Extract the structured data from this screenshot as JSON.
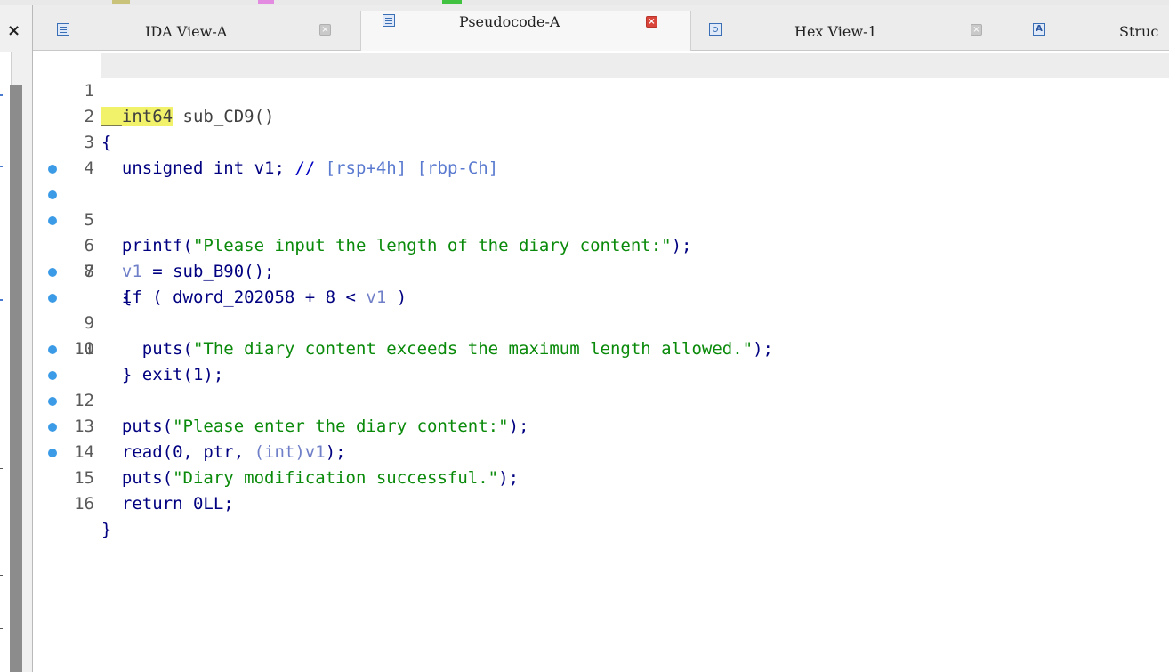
{
  "tabs": [
    {
      "label": "IDA View-A",
      "icon": "ida-view-icon",
      "active": false
    },
    {
      "label": "Pseudocode-A",
      "icon": "pseudocode-icon",
      "active": true
    },
    {
      "label": "Hex View-1",
      "icon": "hex-view-icon",
      "active": false
    },
    {
      "label": "Struc",
      "icon": "structures-icon",
      "active": false
    }
  ],
  "struc_icon_letter": "A",
  "left_close": "×",
  "code": {
    "lines": [
      {
        "n": "1",
        "bp": false
      },
      {
        "n": "2",
        "bp": false
      },
      {
        "n": "3",
        "bp": false
      },
      {
        "n": "4",
        "bp": false
      },
      {
        "n": "5",
        "bp": true
      },
      {
        "n": "6",
        "bp": true
      },
      {
        "n": "7",
        "bp": true
      },
      {
        "n": "8",
        "bp": false
      },
      {
        "n": "9",
        "bp": true
      },
      {
        "n": "10",
        "bp": true
      },
      {
        "n": "11",
        "bp": false
      },
      {
        "n": "12",
        "bp": true
      },
      {
        "n": "13",
        "bp": true
      },
      {
        "n": "14",
        "bp": true
      },
      {
        "n": "15",
        "bp": true
      },
      {
        "n": "16",
        "bp": true
      }
    ],
    "l1": {
      "type": "__int64",
      "name": " sub_CD9()"
    },
    "l2": {
      "text": "{"
    },
    "l3": {
      "decl": "  unsigned int v1; ",
      "comment": "// ",
      "addr": "[rsp+4h] [rbp-Ch]"
    },
    "l5": {
      "pre": "  printf(",
      "str": "\"Please input the length of the diary content:\"",
      "post": ");"
    },
    "l6": {
      "var": "  v1",
      "rest": " = sub_B90();"
    },
    "l7": {
      "pre": "  if ( dword_202058 + 8 < ",
      "var": "v1",
      "post": " )"
    },
    "l8": {
      "text": "  {"
    },
    "l9": {
      "pre": "    puts(",
      "str": "\"The diary content exceeds the maximum length allowed.\"",
      "post": ");"
    },
    "l10": {
      "text": "    exit(1);"
    },
    "l11": {
      "text": "  }"
    },
    "l12": {
      "pre": "  puts(",
      "str": "\"Please enter the diary content:\"",
      "post": ");"
    },
    "l13": {
      "pre": "  read(0, ptr, ",
      "cast": "(int)",
      "var": "v1",
      "post": ");"
    },
    "l14": {
      "pre": "  puts(",
      "str": "\"Diary modification successful.\"",
      "post": ");"
    },
    "l15": {
      "text": "  return 0LL;"
    },
    "l16": {
      "text": "}"
    }
  },
  "colors": {
    "code": "#000080",
    "string": "#0a8a0a",
    "comment": "#0000c0",
    "variable": "#6f7fc8",
    "type_highlight": "#f2f26a",
    "breakpoint_dot": "#3c9be6",
    "close_active": "#d9453a"
  }
}
